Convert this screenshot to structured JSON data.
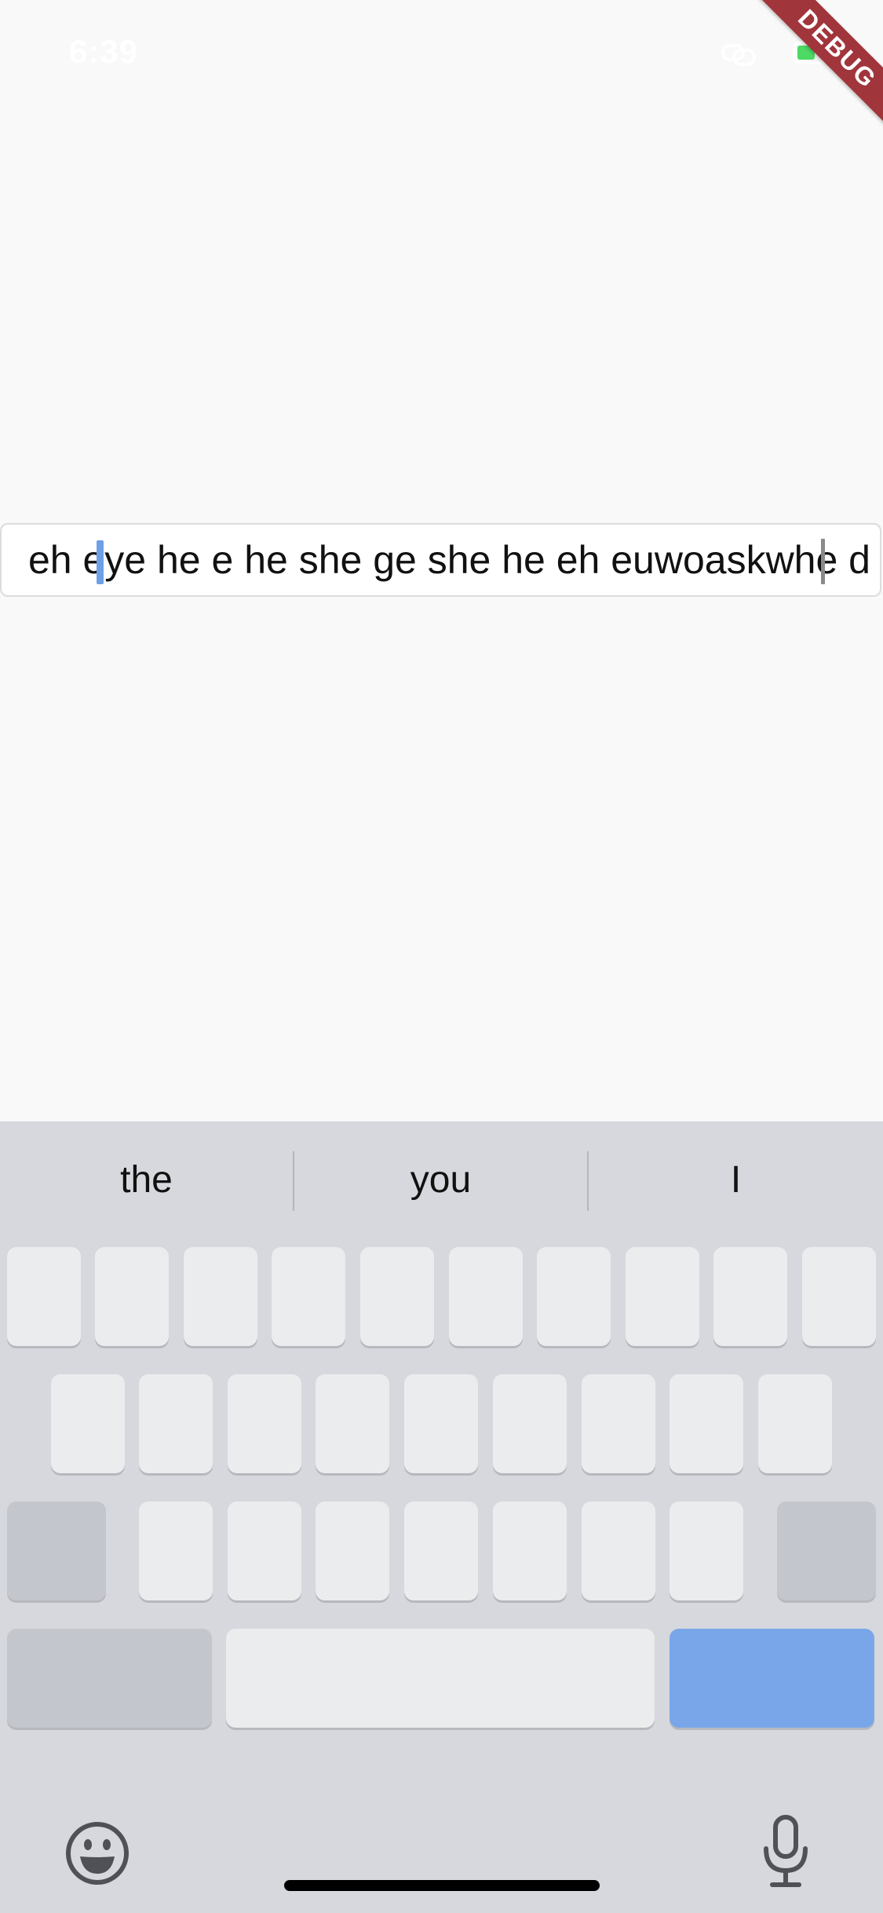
{
  "status_bar": {
    "time": "6:39"
  },
  "debug_banner": {
    "label": "DEBUG"
  },
  "text_field": {
    "value": "eh eye he e he she ge she he eh euwoaskwhe d"
  },
  "predictions": {
    "items": [
      "the",
      "you",
      "I"
    ]
  },
  "icons": {
    "emoji": "emoji-icon",
    "mic": "microphone-icon"
  },
  "colors": {
    "action_key": "#78a6e8",
    "selection_handle": "#6da1e6",
    "debug_banner": "#a1353c"
  }
}
